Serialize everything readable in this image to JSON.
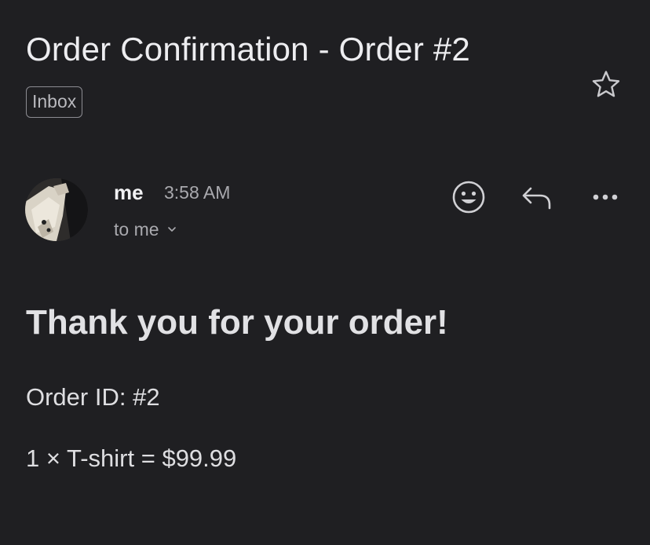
{
  "email": {
    "subject": "Order Confirmation - Order #2",
    "label": "Inbox",
    "starred": false
  },
  "message": {
    "sender": "me",
    "time": "3:58 AM",
    "recipient": "to me",
    "actions": [
      "emoji-reaction-icon",
      "reply-icon",
      "more-options-icon"
    ]
  },
  "content": {
    "heading": "Thank you for your order!",
    "order_id_line": "Order ID: #2",
    "item_line": "1 × T-shirt = $99.99"
  },
  "colors": {
    "background": "#1f1f22",
    "text_primary": "#ededf0",
    "text_secondary": "#a9a9ae"
  }
}
